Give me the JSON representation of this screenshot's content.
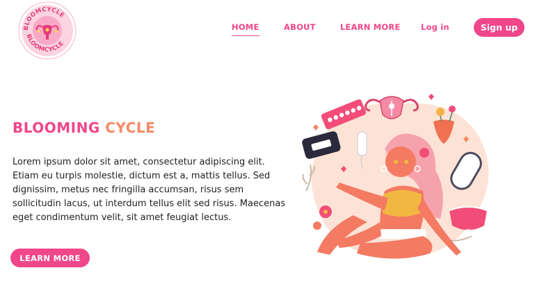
{
  "brand": {
    "logo_text": "BLOOMCYCLE"
  },
  "nav": {
    "items": [
      {
        "label": "HOME",
        "active": true
      },
      {
        "label": "ABOUT"
      },
      {
        "label": "LEARN MORE"
      },
      {
        "label": "Log in"
      }
    ],
    "signup_label": "Sign up"
  },
  "hero": {
    "title_part1": "BLOOMING",
    "title_part2": "CYCLE",
    "body": "Lorem ipsum dolor sit amet, consectetur adipiscing elit. Etiam eu turpis molestie, dictum est a, mattis tellus. Sed dignissim, metus nec fringilla accumsan, risus sem sollicitudin lacus, ut interdum tellus elit sed risus. Maecenas eget condimentum velit, sit amet feugiat lectus.",
    "cta_label": "LEARN MORE"
  },
  "colors": {
    "primary": "#f0468a",
    "secondary": "#f48a65",
    "text": "#1f1f1f",
    "blob": "#fde3d6"
  }
}
